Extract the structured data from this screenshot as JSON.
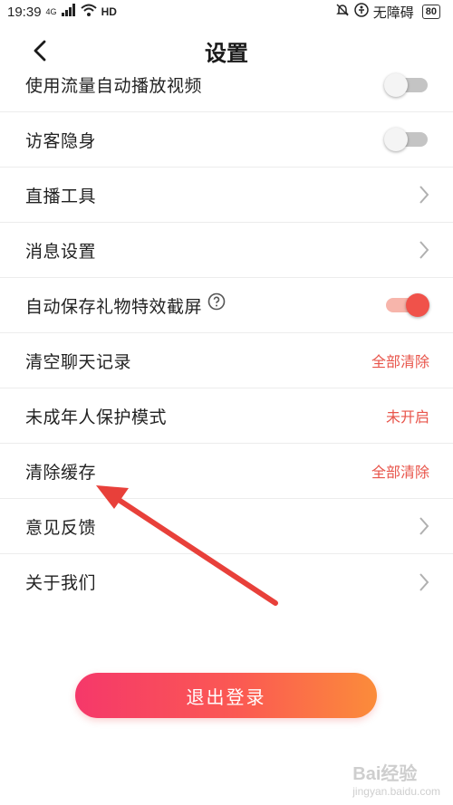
{
  "status_bar": {
    "time": "19:39",
    "signal_tag": "4G",
    "hd_label": "HD",
    "accessibility_label": "无障碍",
    "battery": "80"
  },
  "header": {
    "title": "设置"
  },
  "settings": {
    "autoplay_video": {
      "label": "使用流量自动播放视频",
      "enabled": false
    },
    "visitor_invisible": {
      "label": "访客隐身",
      "enabled": false
    },
    "live_tools": {
      "label": "直播工具"
    },
    "message_settings": {
      "label": "消息设置"
    },
    "auto_save_gift": {
      "label": "自动保存礼物特效截屏",
      "enabled": true
    },
    "clear_chat": {
      "label": "清空聊天记录",
      "action": "全部清除"
    },
    "minor_mode": {
      "label": "未成年人保护模式",
      "status": "未开启"
    },
    "clear_cache": {
      "label": "清除缓存",
      "action": "全部清除"
    },
    "feedback": {
      "label": "意见反馈"
    },
    "about_us": {
      "label": "关于我们"
    }
  },
  "logout": {
    "label": "退出登录"
  },
  "watermark": {
    "brand": "Bai经验",
    "url": "jingyan.baidu.com"
  },
  "colors": {
    "accent": "#e8544a",
    "toggle_on": "#f0524a",
    "gradient_start": "#f5386a",
    "gradient_end": "#fb8c3a",
    "annotation_arrow": "#e8403a"
  }
}
